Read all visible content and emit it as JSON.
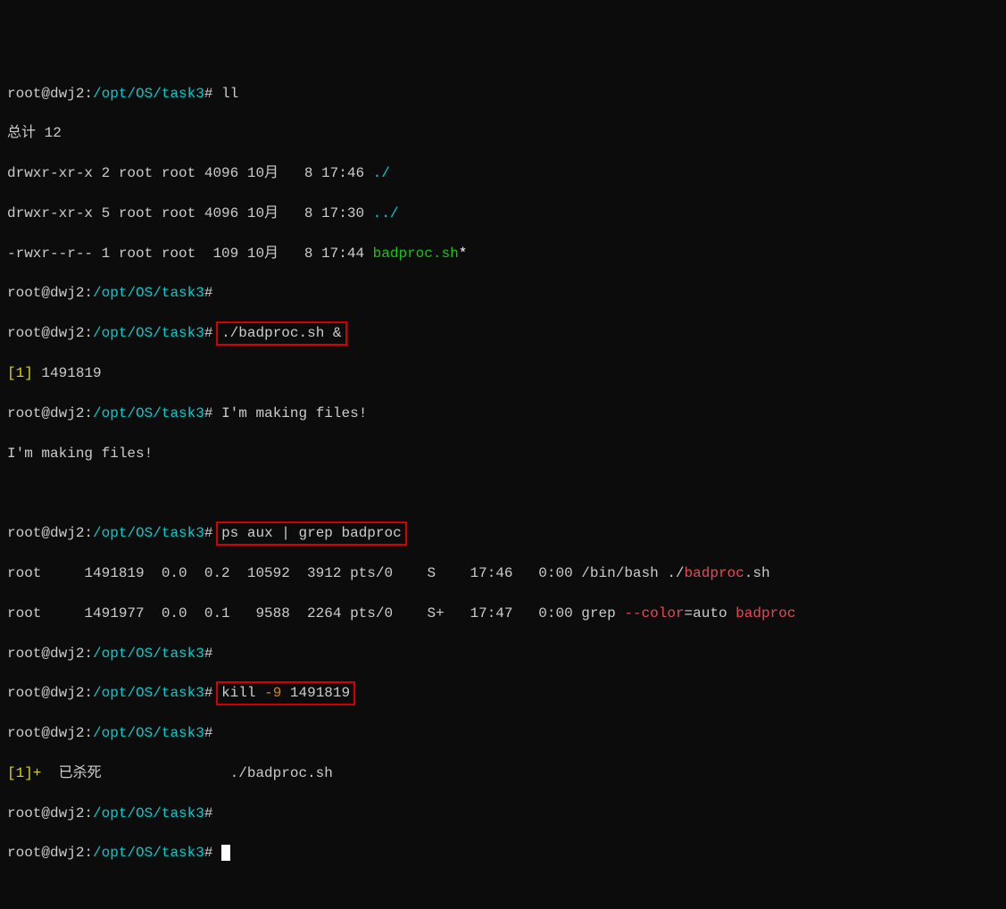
{
  "prompt": {
    "user_host": "root@dwj2",
    "cwd": "/opt/OS/task3",
    "sep": ":",
    "sym": "#"
  },
  "cmd_ll": "ll",
  "total_line": "总计 12",
  "ls": {
    "row1": {
      "perm": "drwxr-xr-x 2 root root 4096 10月   8 17:46 ",
      "name": "./"
    },
    "row2": {
      "perm": "drwxr-xr-x 5 root root 4096 10月   8 17:30 ",
      "name": "../"
    },
    "row3": {
      "perm": "-rwxr--r-- 1 root root  109 10月   8 17:44 ",
      "name": "badproc.sh",
      "suffix": "*"
    }
  },
  "cmd_run": "./badproc.sh &",
  "job_launch": {
    "bracket": "[1]",
    "pid": " 1491819"
  },
  "making_files": "I'm making files!",
  "cmd_ps": "ps aux | grep badproc",
  "ps": {
    "r1": {
      "c0": "root     1491819  0.0  0.2  10592  3912 pts/0    S    17:46   0:00 /bin/bash ./",
      "badproc": "badproc",
      "tail": ".sh"
    },
    "r2": {
      "c0": "root     1491977  0.0  0.1   9588  2264 pts/0    S+   17:47   0:00 grep ",
      "flag": "--color",
      "eq": "=auto ",
      "badproc": "badproc"
    }
  },
  "cmd_kill_head": "kill ",
  "cmd_kill_flag": "-9",
  "cmd_kill_tail": " 1491819",
  "killed": {
    "job": "[1]+  ",
    "txt": "已杀死",
    "pad": "               ./badproc.sh"
  }
}
